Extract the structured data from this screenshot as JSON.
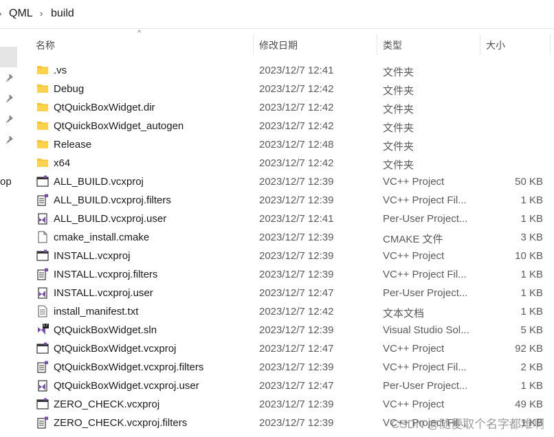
{
  "breadcrumb": {
    "items": [
      "QML",
      "build"
    ]
  },
  "nav": {
    "partial_label": "op"
  },
  "columns": {
    "name": "名称",
    "modified": "修改日期",
    "type": "类型",
    "size": "大小"
  },
  "files": [
    {
      "name": ".vs",
      "modified": "2023/12/7 12:41",
      "type": "文件夹",
      "size": "",
      "icon": "folder-icon"
    },
    {
      "name": "Debug",
      "modified": "2023/12/7 12:42",
      "type": "文件夹",
      "size": "",
      "icon": "folder-icon"
    },
    {
      "name": "QtQuickBoxWidget.dir",
      "modified": "2023/12/7 12:42",
      "type": "文件夹",
      "size": "",
      "icon": "folder-icon"
    },
    {
      "name": "QtQuickBoxWidget_autogen",
      "modified": "2023/12/7 12:42",
      "type": "文件夹",
      "size": "",
      "icon": "folder-icon"
    },
    {
      "name": "Release",
      "modified": "2023/12/7 12:48",
      "type": "文件夹",
      "size": "",
      "icon": "folder-icon"
    },
    {
      "name": "x64",
      "modified": "2023/12/7 12:42",
      "type": "文件夹",
      "size": "",
      "icon": "folder-icon"
    },
    {
      "name": "ALL_BUILD.vcxproj",
      "modified": "2023/12/7 12:39",
      "type": "VC++ Project",
      "size": "50 KB",
      "icon": "vcxproj-icon"
    },
    {
      "name": "ALL_BUILD.vcxproj.filters",
      "modified": "2023/12/7 12:39",
      "type": "VC++ Project Fil...",
      "size": "1 KB",
      "icon": "vcxproj-filters-icon"
    },
    {
      "name": "ALL_BUILD.vcxproj.user",
      "modified": "2023/12/7 12:41",
      "type": "Per-User Project...",
      "size": "1 KB",
      "icon": "vcxproj-user-icon"
    },
    {
      "name": "cmake_install.cmake",
      "modified": "2023/12/7 12:39",
      "type": "CMAKE 文件",
      "size": "3 KB",
      "icon": "file-icon"
    },
    {
      "name": "INSTALL.vcxproj",
      "modified": "2023/12/7 12:39",
      "type": "VC++ Project",
      "size": "10 KB",
      "icon": "vcxproj-icon"
    },
    {
      "name": "INSTALL.vcxproj.filters",
      "modified": "2023/12/7 12:39",
      "type": "VC++ Project Fil...",
      "size": "1 KB",
      "icon": "vcxproj-filters-icon"
    },
    {
      "name": "INSTALL.vcxproj.user",
      "modified": "2023/12/7 12:47",
      "type": "Per-User Project...",
      "size": "1 KB",
      "icon": "vcxproj-user-icon"
    },
    {
      "name": "install_manifest.txt",
      "modified": "2023/12/7 12:42",
      "type": "文本文档",
      "size": "1 KB",
      "icon": "text-file-icon"
    },
    {
      "name": "QtQuickBoxWidget.sln",
      "modified": "2023/12/7 12:39",
      "type": "Visual Studio Sol...",
      "size": "5 KB",
      "icon": "sln-icon"
    },
    {
      "name": "QtQuickBoxWidget.vcxproj",
      "modified": "2023/12/7 12:47",
      "type": "VC++ Project",
      "size": "92 KB",
      "icon": "vcxproj-icon"
    },
    {
      "name": "QtQuickBoxWidget.vcxproj.filters",
      "modified": "2023/12/7 12:39",
      "type": "VC++ Project Fil...",
      "size": "2 KB",
      "icon": "vcxproj-filters-icon"
    },
    {
      "name": "QtQuickBoxWidget.vcxproj.user",
      "modified": "2023/12/7 12:47",
      "type": "Per-User Project...",
      "size": "1 KB",
      "icon": "vcxproj-user-icon"
    },
    {
      "name": "ZERO_CHECK.vcxproj",
      "modified": "2023/12/7 12:39",
      "type": "VC++ Project",
      "size": "49 KB",
      "icon": "vcxproj-icon"
    },
    {
      "name": "ZERO_CHECK.vcxproj.filters",
      "modified": "2023/12/7 12:39",
      "type": "VC++ Project Fil...",
      "size": "1 KB",
      "icon": "vcxproj-filters-icon"
    }
  ],
  "sln_badge": "17",
  "watermark": "CSDN @随便取个名字都难啊",
  "colors": {
    "folder": "#f5c22e",
    "vs_purple": "#7b4fae",
    "selected": "#e5e5e5"
  }
}
